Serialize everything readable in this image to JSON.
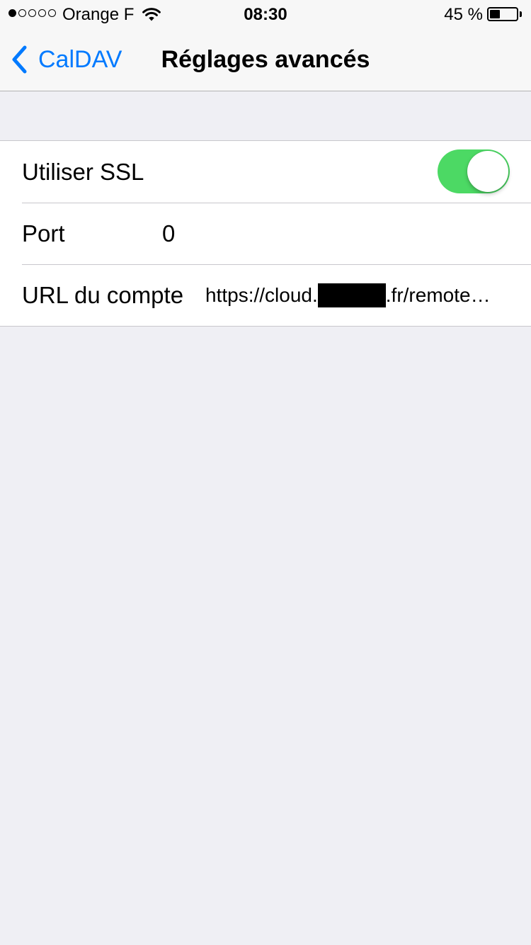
{
  "status_bar": {
    "signal_bars_filled": 1,
    "signal_bars_total": 5,
    "carrier": "Orange F",
    "wifi_icon": "wifi-icon",
    "time": "08:30",
    "battery_percent_text": "45 %",
    "battery_level": 0.45
  },
  "nav": {
    "back_label": "CalDAV",
    "back_icon": "chevron-left-icon",
    "title": "Réglages avancés",
    "accent_color": "#007aff"
  },
  "settings": {
    "ssl": {
      "label": "Utiliser SSL",
      "enabled": true,
      "toggle_color": "#4cd964"
    },
    "port": {
      "label": "Port",
      "value": "0"
    },
    "url": {
      "label": "URL du compte",
      "value_prefix": "https://cloud.",
      "value_suffix": ".fr/remote…",
      "redacted": true
    }
  }
}
